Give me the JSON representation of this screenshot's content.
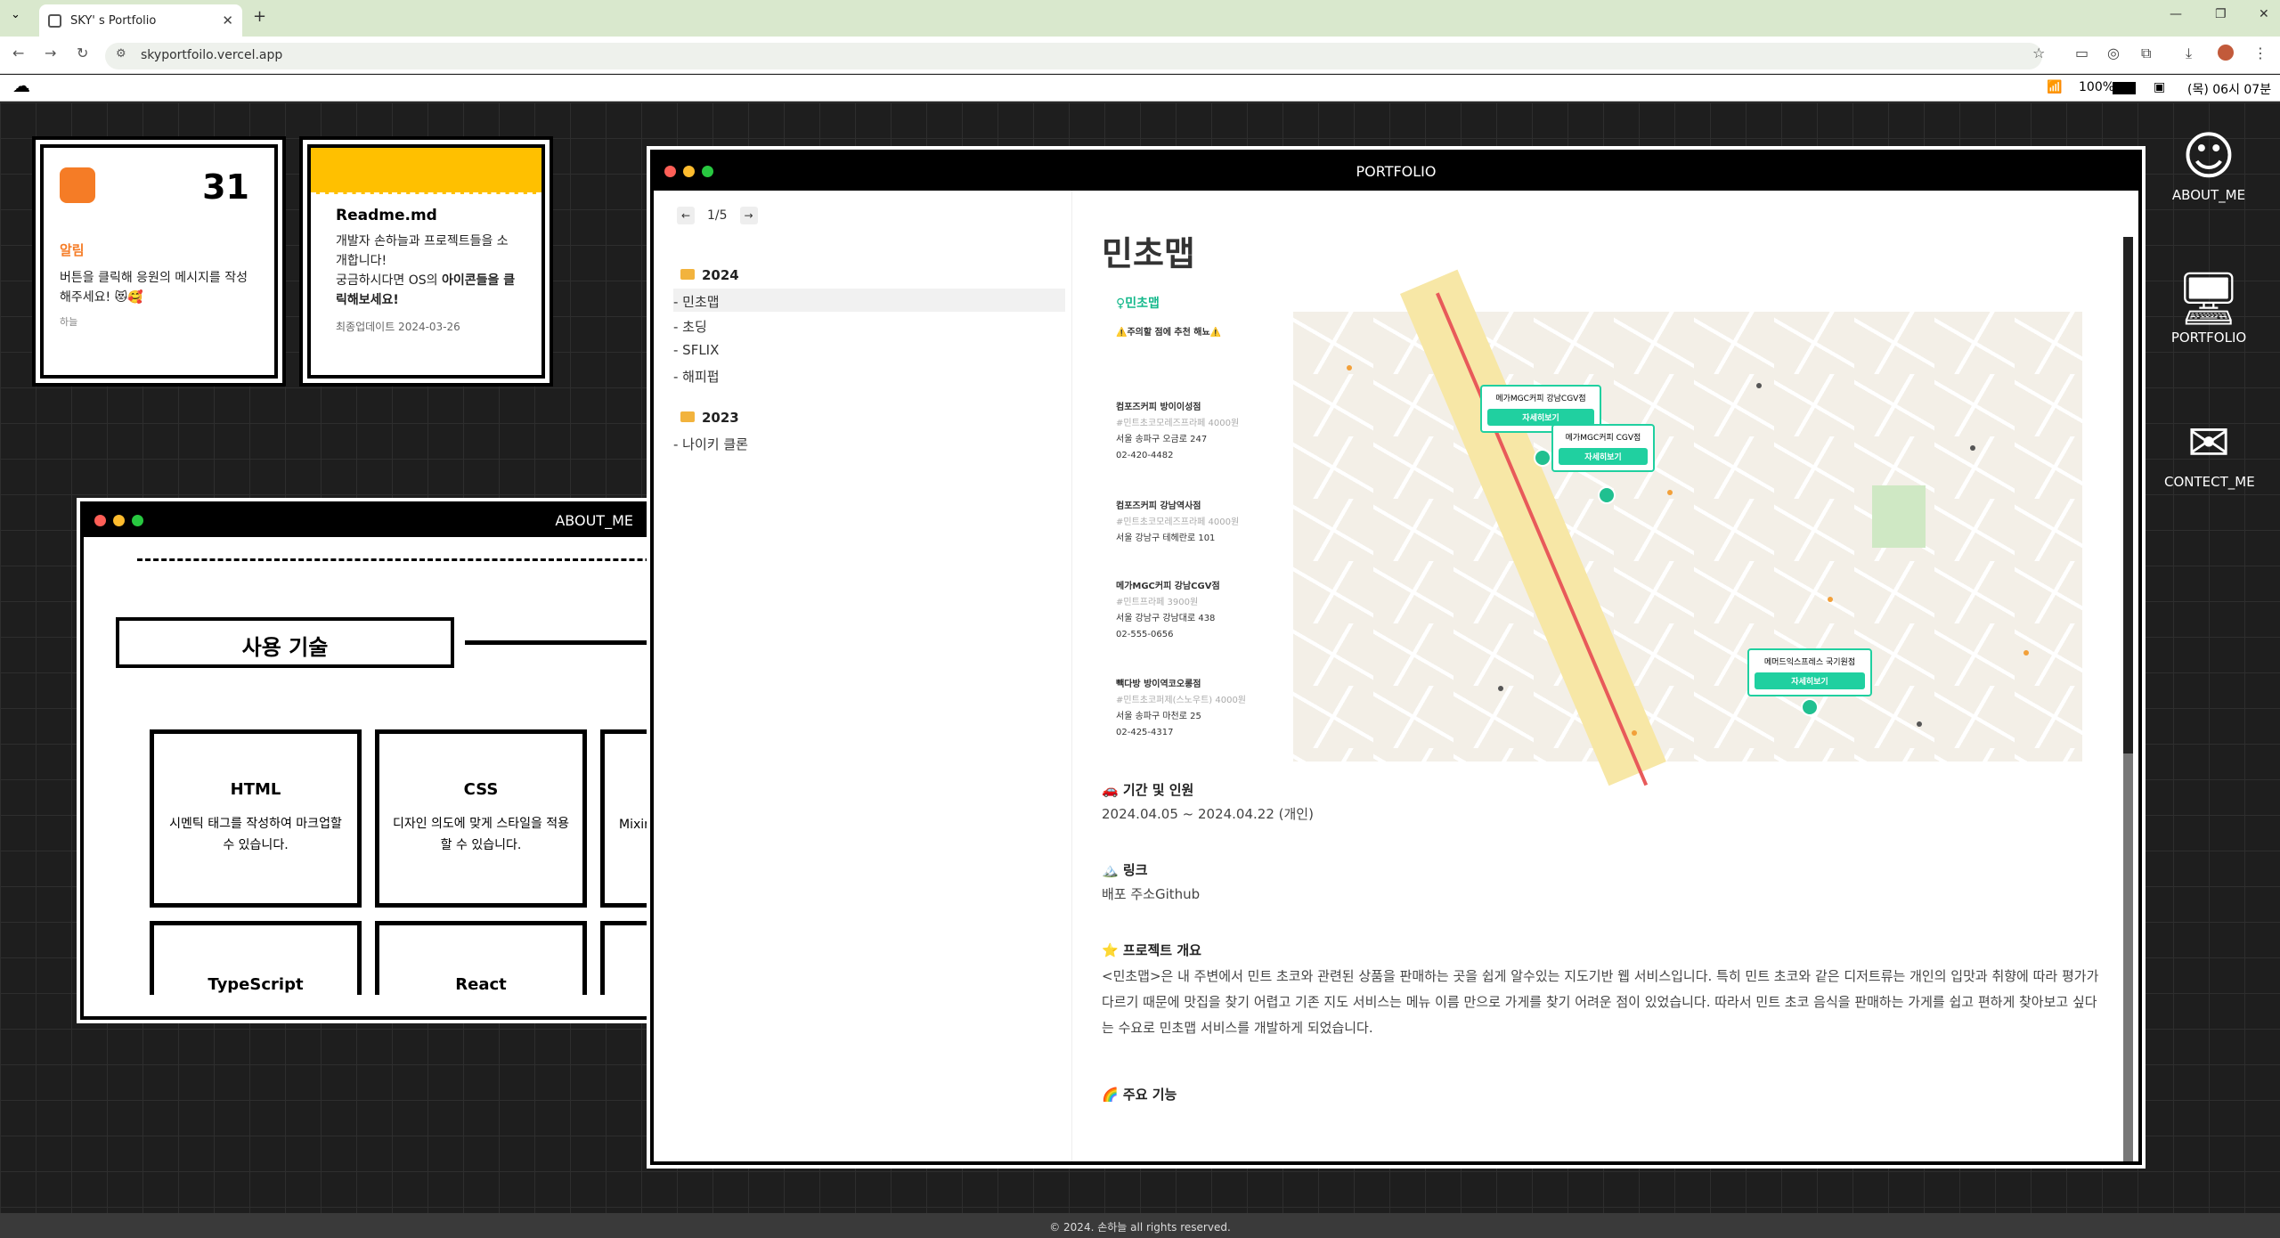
{
  "browser": {
    "tab_title": "SKY' s Portfolio",
    "url": "skyportfoilo.vercel.app"
  },
  "menubar": {
    "battery": "100%",
    "time": "(목) 06시 07분"
  },
  "widgets": {
    "notice": {
      "day": "31",
      "label": "알림",
      "message": "버튼을 클릭해 응원의 메시지를 작성해주세요! 😻🥰",
      "author": "하늘"
    },
    "readme": {
      "title": "Readme.md",
      "line1": "개발자 손하늘과 프로젝트들을 소개합니다!",
      "line2a": "궁금하시다면 OS의 ",
      "line2b": "아이콘들을 클릭",
      "line2c": "해보세요!",
      "updated": "최종업데이트 2024-03-26"
    }
  },
  "about_window": {
    "title": "ABOUT_ME",
    "section": "사용 기술",
    "cards": [
      {
        "name": "HTML",
        "desc": "시멘틱 태그를 작성하여 마크업할 수 있습니다."
      },
      {
        "name": "CSS",
        "desc": "디자인 의도에 맞게 스타일을 적용할 수 있습니다."
      },
      {
        "name": "",
        "desc": "Mixin"
      },
      {
        "name": "TypeScript",
        "desc": ""
      },
      {
        "name": "React",
        "desc": ""
      }
    ]
  },
  "portfolio_window": {
    "title": "PORTFOLIO",
    "pager": "1/5",
    "years": [
      {
        "year": "2024",
        "items": [
          "- 민초맵",
          "- 초딩",
          "- SFLIX",
          "- 해피펍"
        ]
      },
      {
        "year": "2023",
        "items": [
          "- 나이키 클론"
        ]
      }
    ],
    "content": {
      "title": "민초맵",
      "period_heading": "🚗 기간 및 인원",
      "period": "2024.04.05 ~ 2024.04.22 (개인)",
      "link_heading": "🏔️ 링크",
      "links": "배포 주소Github",
      "overview_heading": "⭐ 프로젝트 개요",
      "overview_l1": "<민초맵>은 내 주변에서 민트 초코와 관련된 상품을 판매하는 곳을 쉽게 알수있는 지도기반 웹 서비스입니다. 특히 민트 초코와 같은 디저트류는 개인의 입맛과 취향에 따라 평가가",
      "overview_l2": "다르기 때문에 맛집을 찾기 어렵고 기존 지도 서비스는 메뉴 이름 만으로 가게를 찾기 어려운 점이 있었습니다. 따라서 민트 초코 음식을 판매하는 가게를 쉽고 편하게 찾아보고 싶다",
      "overview_l3": "는 수요로 민초맵 서비스를 개발하게 되었습니다.",
      "features_heading": "🌈 주요 기능"
    },
    "screenshot": {
      "logo": "♀민초맵",
      "tagline": "⚠️주의할 점에 추천 해뇨⚠️",
      "stores": [
        {
          "name": "컴포즈커피 방이이성점",
          "tag": "#민트초코모레즈프라페 4000원",
          "addr": "서울 송파구 오금로 247",
          "tel": "02-420-4482"
        },
        {
          "name": "컴포즈커피 강남역사점",
          "tag": "#민트초코모레즈프라페 4000원",
          "addr": "서울 강남구 테헤란로 101",
          "tel": ""
        },
        {
          "name": "메가MGC커피 강남CGV점",
          "tag": "#민트프라페 3900원",
          "addr": "서울 강남구 강남대로 438",
          "tel": "02-555-0656"
        },
        {
          "name": "빽다방 방이역코오롱점",
          "tag": "#민트초코퍼제(스노우트) 4000원",
          "addr": "서울 송파구 마천로 25",
          "tel": "02-425-4317"
        }
      ],
      "popups": [
        {
          "title": "메가MGC커피 강남CGV점",
          "btn": "자세히보기"
        },
        {
          "title": "메가MGC커피 CGV점",
          "btn": "자세히보기"
        },
        {
          "title": "메머드익스프레스 국기원점",
          "btn": "자세히보기"
        }
      ]
    }
  },
  "desktop_icons": [
    "ABOUT_ME",
    "PORTFOLIO",
    "CONTECT_ME"
  ],
  "footer": "© 2024. 손하늘 all rights reserved.",
  "colors": {
    "accent_orange": "#f57c26",
    "readme_yellow": "#ffc000",
    "mint": "#20d0a0"
  }
}
